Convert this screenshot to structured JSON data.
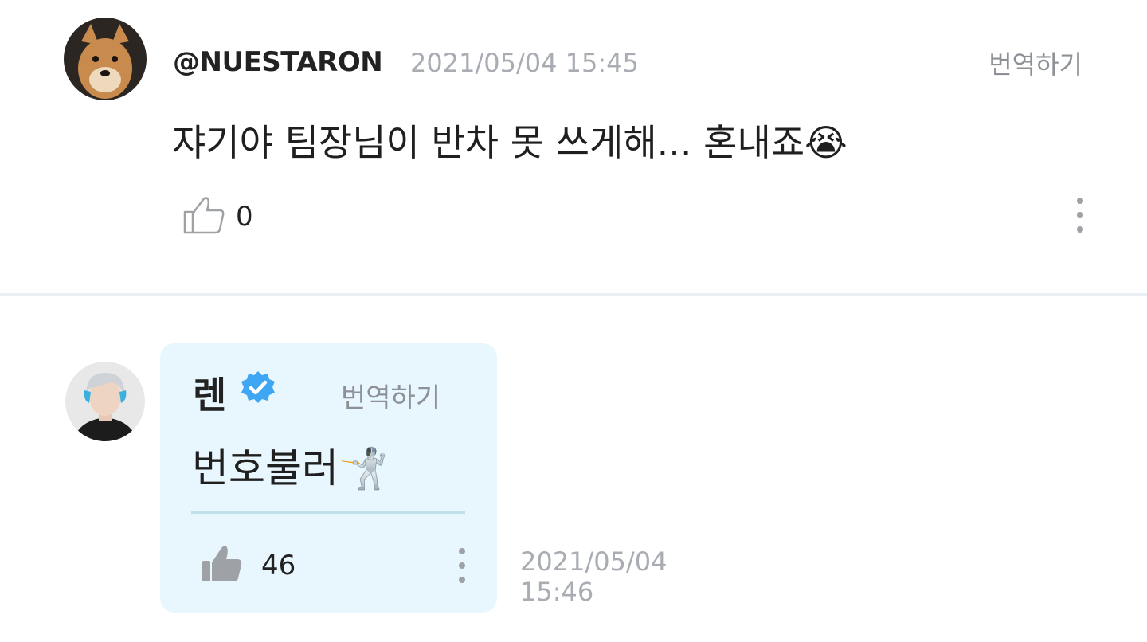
{
  "comment": {
    "avatar_icon": "shiba-dog-avatar",
    "handle": "@NUESTARON",
    "timestamp": "2021/05/04 15:45",
    "translate_label": "번역하기",
    "message": "쟈기야 팀장님이 반차 못 쓰게해... 혼내죠😭",
    "like_icon": "thumbs-up-outline-icon",
    "like_count": "0",
    "more_icon": "vertical-dots-icon"
  },
  "reply": {
    "avatar_icon": "artist-avatar",
    "name": "렌",
    "verified_icon": "verified-badge-icon",
    "translate_label": "번역하기",
    "message": "번호불러🤺",
    "like_icon": "thumbs-up-filled-icon",
    "like_count": "46",
    "more_icon": "vertical-dots-icon",
    "timestamp_date": "2021/05/04",
    "timestamp_time": "15:46",
    "bubble_color": "#e8f6fd",
    "verified_color": "#3ea6f2"
  }
}
